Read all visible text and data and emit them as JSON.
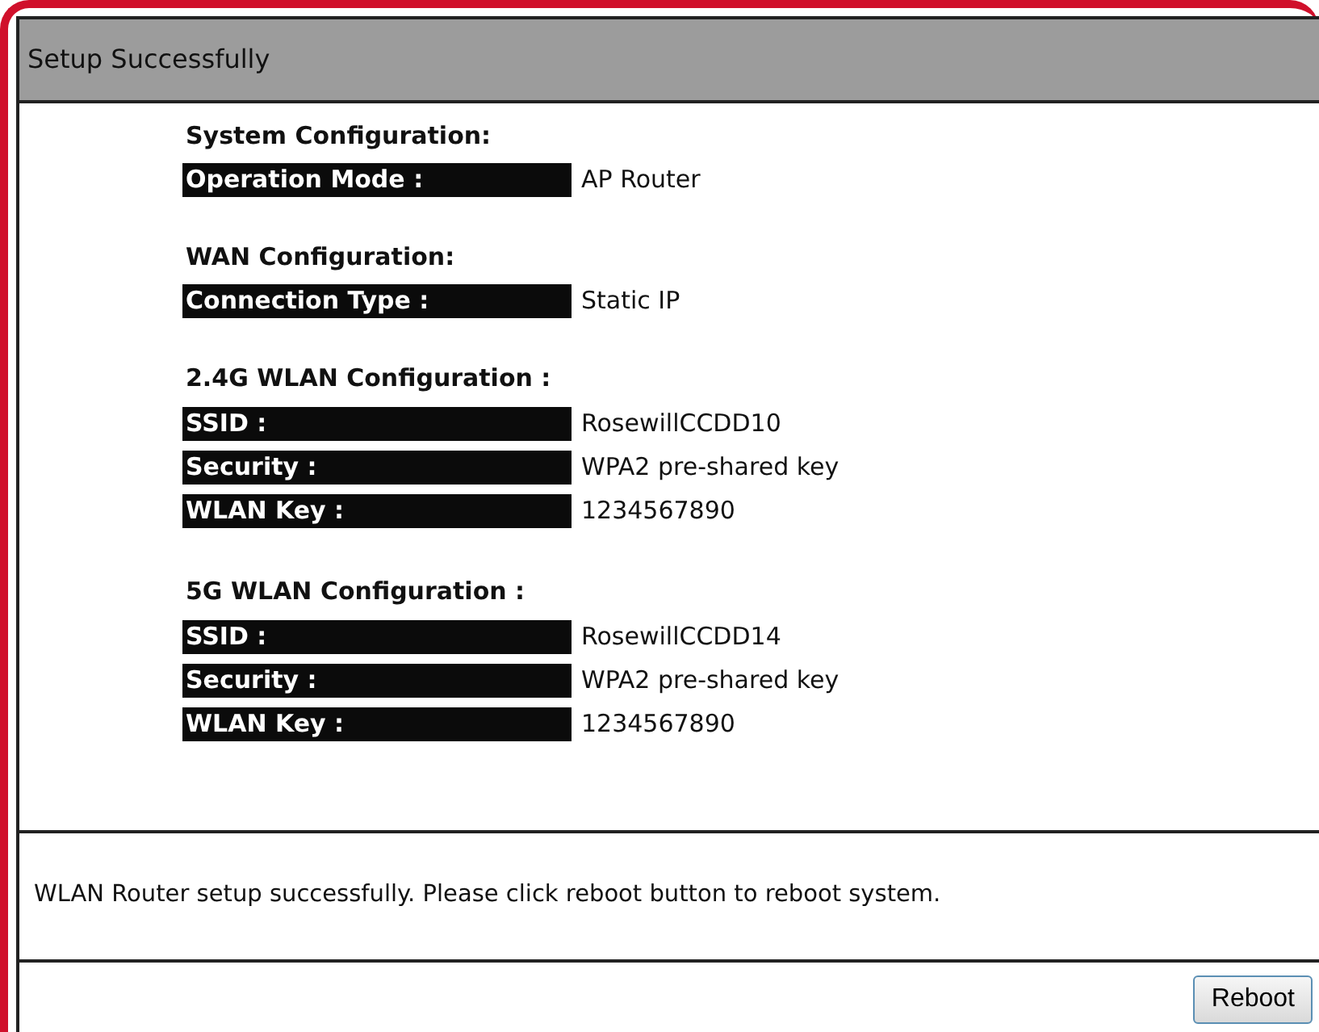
{
  "panel": {
    "title": "Setup Successfully",
    "sections": [
      {
        "heading": "System Configuration:",
        "rows": [
          {
            "label": "Operation Mode :",
            "value": "AP Router"
          }
        ]
      },
      {
        "heading": "WAN Configuration:",
        "rows": [
          {
            "label": "Connection Type :",
            "value": "Static IP"
          }
        ]
      },
      {
        "heading": "2.4G WLAN Configuration :",
        "rows": [
          {
            "label": "SSID :",
            "value": "RosewillCCDD10"
          },
          {
            "label": "Security :",
            "value": "WPA2 pre-shared key"
          },
          {
            "label": "WLAN Key :",
            "value": "1234567890"
          }
        ]
      },
      {
        "heading": "5G WLAN Configuration :",
        "rows": [
          {
            "label": "SSID :",
            "value": "RosewillCCDD14"
          },
          {
            "label": "Security :",
            "value": "WPA2 pre-shared key"
          },
          {
            "label": "WLAN Key :",
            "value": "1234567890"
          }
        ]
      }
    ],
    "message": "WLAN Router setup successfully. Please click reboot button to reboot system.",
    "button": "Reboot"
  }
}
